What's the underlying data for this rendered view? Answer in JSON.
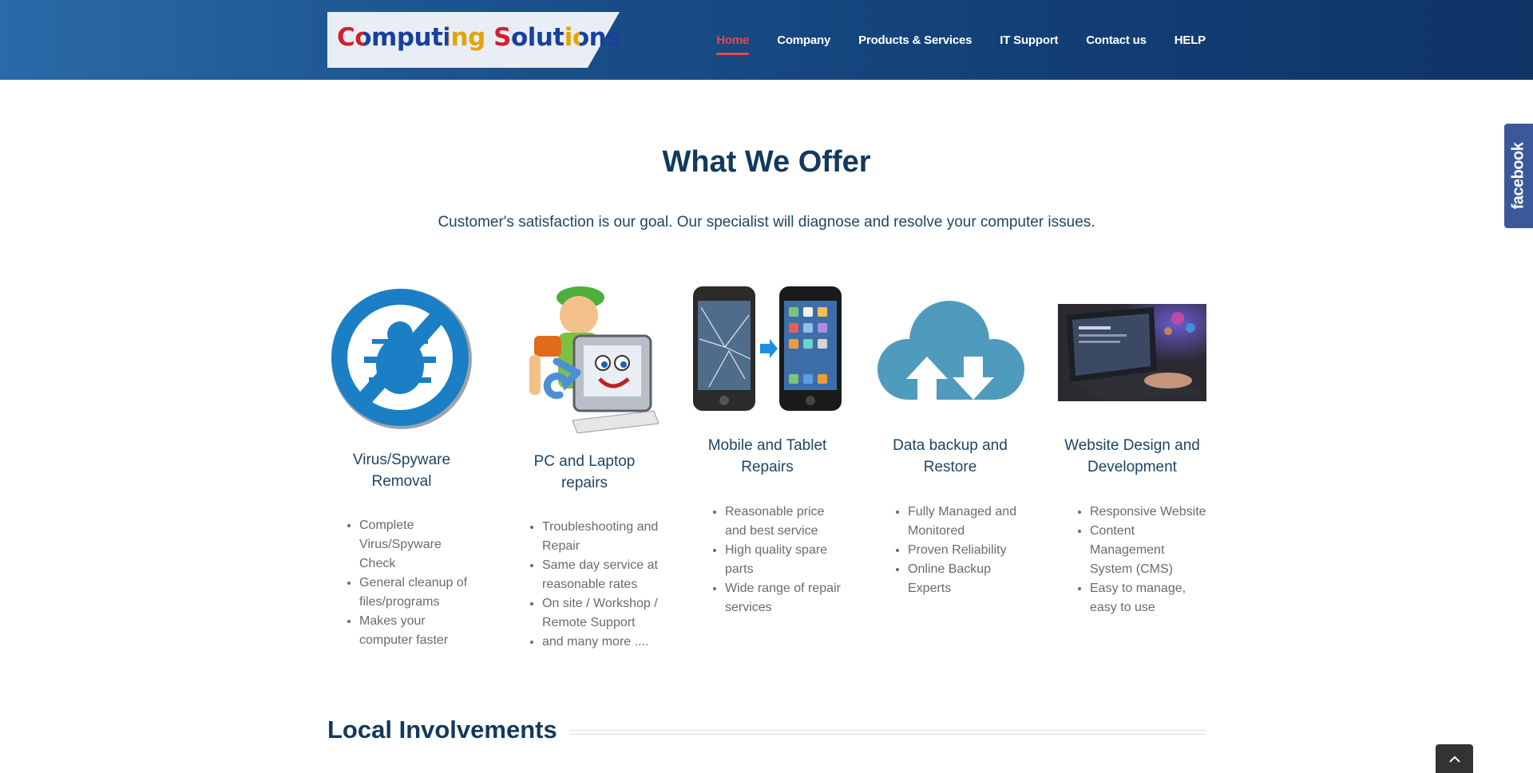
{
  "brand": {
    "logo_word1": "Computing",
    "logo_word2": "Solutions"
  },
  "nav": {
    "items": [
      {
        "label": "Home",
        "active": true
      },
      {
        "label": "Company",
        "active": false
      },
      {
        "label": "Products & Services",
        "active": false
      },
      {
        "label": "IT Support",
        "active": false
      },
      {
        "label": "Contact us",
        "active": false
      },
      {
        "label": "HELP",
        "active": false
      }
    ]
  },
  "facebook": {
    "label": "facebook"
  },
  "offer": {
    "title": "What We Offer",
    "subtitle": "Customer's satisfaction is our goal. Our specialist will diagnose and resolve your computer issues.",
    "cards": [
      {
        "title": "Virus/Spyware Removal",
        "icon": "no-bug-icon",
        "bullets": [
          "Complete Virus/Spyware Check",
          "General cleanup of files/programs",
          "Makes your computer faster"
        ]
      },
      {
        "title": "PC and Laptop repairs",
        "icon": "repairman-computer-illustration",
        "bullets": [
          "Troubleshooting and Repair",
          "Same day service at reasonable rates",
          "On site / Workshop / Remote Support",
          "and many more ...."
        ]
      },
      {
        "title": "Mobile and Tablet Repairs",
        "icon": "phone-repair-image",
        "bullets": [
          "Reasonable price and best service",
          "High quality spare parts",
          "Wide range of repair services"
        ]
      },
      {
        "title": "Data backup and Restore",
        "icon": "cloud-backup-icon",
        "bullets": [
          "Fully Managed and Monitored",
          "Proven Reliability",
          "Online Backup Experts"
        ]
      },
      {
        "title": "Website Design and Development",
        "icon": "laptop-typing-photo",
        "bullets": [
          "Responsive Website",
          "Content Management System (CMS)",
          "Easy to manage, easy to use"
        ]
      }
    ]
  },
  "local": {
    "title": "Local Involvements"
  },
  "colors": {
    "accent": "#e8484d",
    "heading": "#13395c",
    "header_dark": "#0f3466",
    "icon_blue": "#1a7fc4"
  }
}
